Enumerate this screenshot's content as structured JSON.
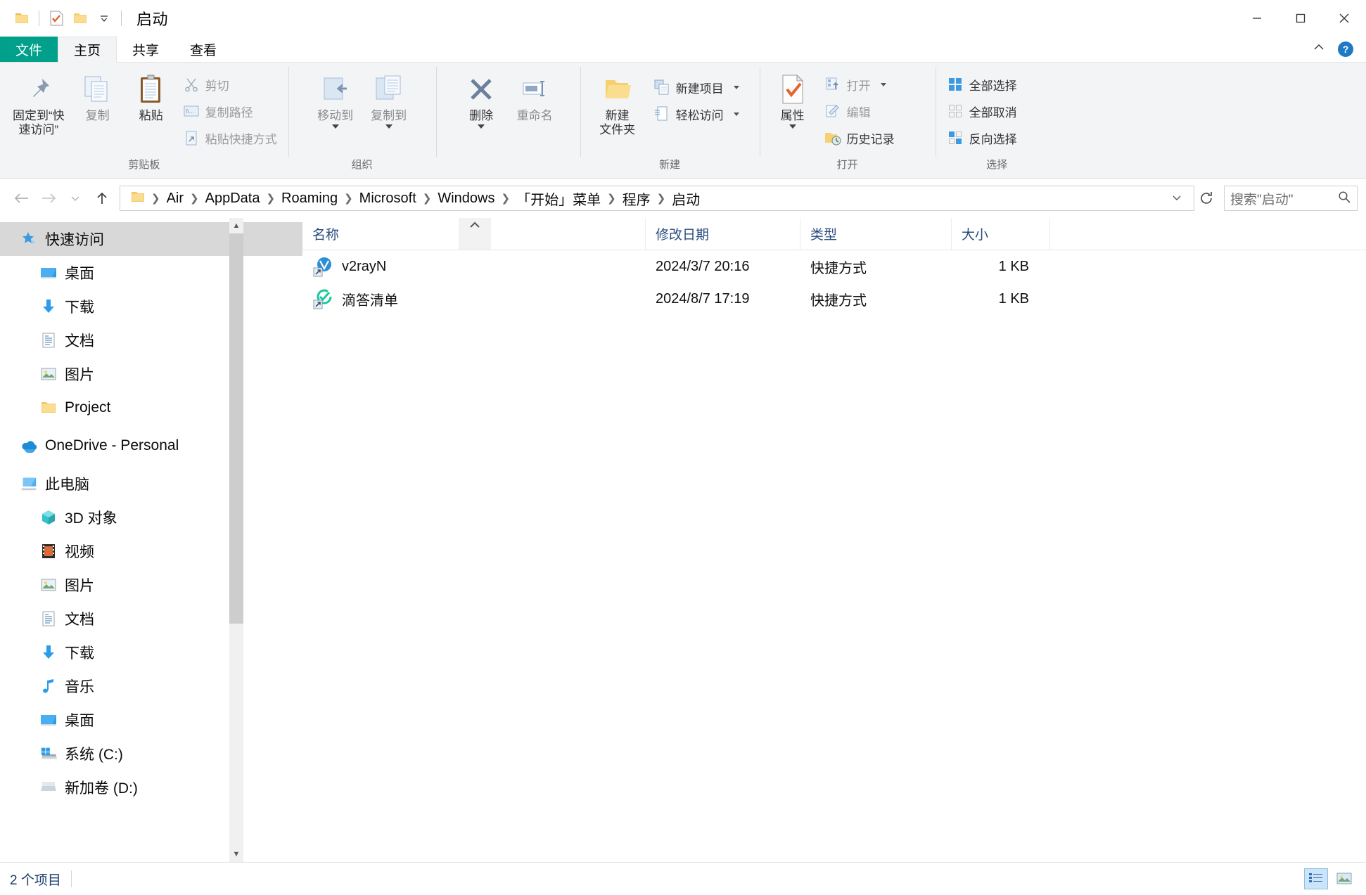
{
  "window": {
    "title": "启动",
    "quick_access_icons": [
      "folder-icon",
      "properties-icon",
      "new-folder-icon",
      "chevron-down-icon"
    ],
    "controls": {
      "minimize": "minimize-icon",
      "maximize": "maximize-icon",
      "close": "close-icon"
    }
  },
  "tabs": {
    "file": "文件",
    "items": [
      {
        "label": "主页",
        "active": true
      },
      {
        "label": "共享",
        "active": false
      },
      {
        "label": "查看",
        "active": false
      }
    ],
    "collapse_icon": "chevron-up-icon",
    "help_icon": "?"
  },
  "ribbon": {
    "groups": [
      {
        "name": "剪贴板",
        "big": [
          {
            "label": "固定到“快\n速访问”",
            "icon": "pin-icon",
            "dim": false
          },
          {
            "label": "复制",
            "icon": "copy-icon",
            "dim": true
          },
          {
            "label": "粘贴",
            "icon": "paste-icon",
            "dim": false
          }
        ],
        "small": [
          {
            "label": "剪切",
            "icon": "scissors-icon",
            "dim": true
          },
          {
            "label": "复制路径",
            "icon": "copy-path-icon",
            "dim": true
          },
          {
            "label": "粘贴快捷方式",
            "icon": "paste-shortcut-icon",
            "dim": true
          }
        ]
      },
      {
        "name": "组织",
        "big": [
          {
            "label": "移动到",
            "icon": "move-to-icon",
            "dim": true,
            "caret": true
          },
          {
            "label": "复制到",
            "icon": "copy-to-icon",
            "dim": true,
            "caret": true
          }
        ],
        "small": []
      },
      {
        "name": "",
        "big": [
          {
            "label": "删除",
            "icon": "delete-icon",
            "dim": false,
            "caret": true
          },
          {
            "label": "重命名",
            "icon": "rename-icon",
            "dim": true
          }
        ],
        "small": []
      },
      {
        "name": "新建",
        "big": [
          {
            "label": "新建\n文件夹",
            "icon": "new-folder-icon",
            "dim": false
          }
        ],
        "small": [
          {
            "label": "新建项目",
            "icon": "new-item-icon",
            "dim": false,
            "caret": true
          },
          {
            "label": "轻松访问",
            "icon": "easy-access-icon",
            "dim": false,
            "caret": true
          }
        ]
      },
      {
        "name": "打开",
        "big": [
          {
            "label": "属性",
            "icon": "properties-icon",
            "dim": false,
            "caret": true
          }
        ],
        "small": [
          {
            "label": "打开",
            "icon": "open-icon",
            "dim": true,
            "caret": true
          },
          {
            "label": "编辑",
            "icon": "edit-icon",
            "dim": true
          },
          {
            "label": "历史记录",
            "icon": "history-icon",
            "dim": false
          }
        ]
      },
      {
        "name": "选择",
        "big": [],
        "small": [
          {
            "label": "全部选择",
            "icon": "select-all-icon",
            "dim": false
          },
          {
            "label": "全部取消",
            "icon": "select-none-icon",
            "dim": false
          },
          {
            "label": "反向选择",
            "icon": "invert-selection-icon",
            "dim": false
          }
        ]
      }
    ]
  },
  "address": {
    "back_icon": "arrow-left-icon",
    "forward_icon": "arrow-right-icon",
    "recent_icon": "chevron-down-icon",
    "up_icon": "arrow-up-icon",
    "root_icon": "folder-icon",
    "crumbs": [
      "Air",
      "AppData",
      "Roaming",
      "Microsoft",
      "Windows",
      "「开始」菜单",
      "程序",
      "启动"
    ],
    "dropdown_icon": "chevron-down-icon",
    "refresh_icon": "refresh-icon",
    "search_placeholder": "搜索\"启动\"",
    "search_icon": "search-icon"
  },
  "sidebar": {
    "items": [
      {
        "label": "快速访问",
        "icon": "star-pin-icon",
        "level": 0,
        "selected": true,
        "pinned": false
      },
      {
        "label": "桌面",
        "icon": "desktop-icon",
        "level": 1,
        "selected": false,
        "pinned": true
      },
      {
        "label": "下载",
        "icon": "download-icon",
        "level": 1,
        "selected": false,
        "pinned": true
      },
      {
        "label": "文档",
        "icon": "document-icon",
        "level": 1,
        "selected": false,
        "pinned": true
      },
      {
        "label": "图片",
        "icon": "pictures-icon",
        "level": 1,
        "selected": false,
        "pinned": true
      },
      {
        "label": "Project",
        "icon": "folder-icon",
        "level": 1,
        "selected": false,
        "pinned": true
      },
      {
        "label": "OneDrive - Personal",
        "icon": "onedrive-icon",
        "level": 0,
        "selected": false,
        "pinned": false
      },
      {
        "label": "此电脑",
        "icon": "this-pc-icon",
        "level": 0,
        "selected": false,
        "pinned": false
      },
      {
        "label": "3D 对象",
        "icon": "3d-objects-icon",
        "level": 1,
        "selected": false,
        "pinned": false
      },
      {
        "label": "视频",
        "icon": "videos-icon",
        "level": 1,
        "selected": false,
        "pinned": false
      },
      {
        "label": "图片",
        "icon": "pictures-icon",
        "level": 1,
        "selected": false,
        "pinned": false
      },
      {
        "label": "文档",
        "icon": "document-icon",
        "level": 1,
        "selected": false,
        "pinned": false
      },
      {
        "label": "下载",
        "icon": "download-icon",
        "level": 1,
        "selected": false,
        "pinned": false
      },
      {
        "label": "音乐",
        "icon": "music-icon",
        "level": 1,
        "selected": false,
        "pinned": false
      },
      {
        "label": "桌面",
        "icon": "desktop-icon",
        "level": 1,
        "selected": false,
        "pinned": false
      },
      {
        "label": "系统 (C:)",
        "icon": "windows-drive-icon",
        "level": 1,
        "selected": false,
        "pinned": false
      },
      {
        "label": "新加卷 (D:)",
        "icon": "drive-icon",
        "level": 1,
        "selected": false,
        "pinned": false
      }
    ],
    "scroll_up_icon": "chevron-up-icon",
    "scroll_down_icon": "chevron-down-icon"
  },
  "filelist": {
    "columns": [
      {
        "label": "名称",
        "key": "name"
      },
      {
        "label": "修改日期",
        "key": "date"
      },
      {
        "label": "类型",
        "key": "type"
      },
      {
        "label": "大小",
        "key": "size"
      }
    ],
    "sort_indicator": "chevron-up-icon",
    "rows": [
      {
        "name": "v2rayN",
        "date": "2024/3/7 20:16",
        "type": "快捷方式",
        "size": "1 KB",
        "icon": "v2rayn-shortcut-icon"
      },
      {
        "name": "滴答清单",
        "date": "2024/8/7 17:19",
        "type": "快捷方式",
        "size": "1 KB",
        "icon": "ticktick-shortcut-icon"
      }
    ]
  },
  "status": {
    "count_text": "2 个项目",
    "view_details_icon": "details-view-icon",
    "view_thumbnails_icon": "large-icons-view-icon"
  },
  "colors": {
    "file_tab": "#00a08a",
    "accent_blue": "#1e7ac4",
    "column_header_text": "#2a4c7d",
    "selection_gray": "#d8d8d8"
  }
}
